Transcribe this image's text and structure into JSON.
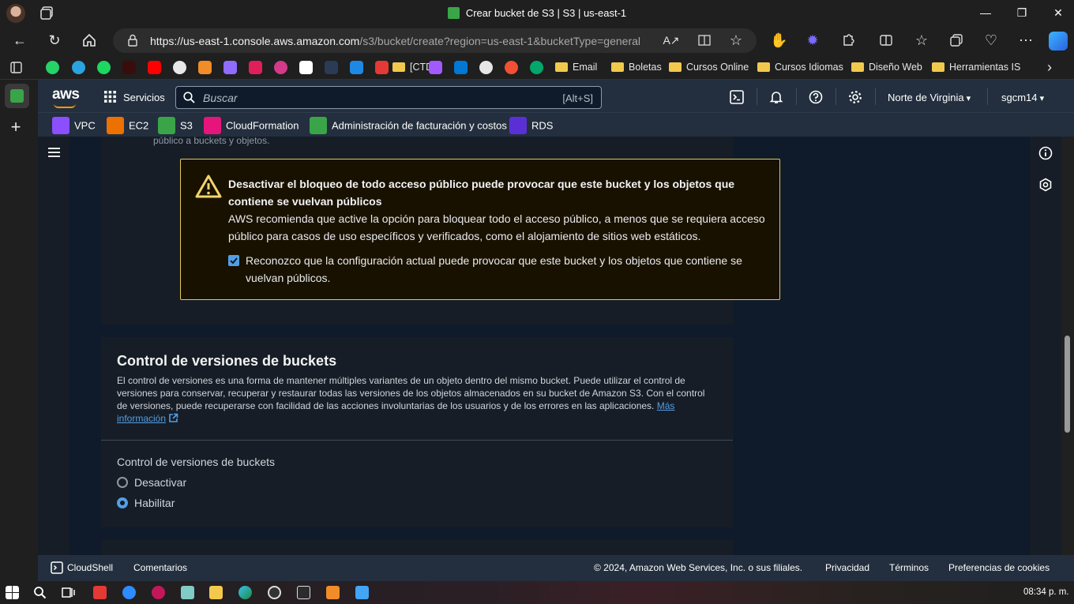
{
  "browser": {
    "window_title": "Crear bucket de S3 | S3 | us-east-1",
    "url_host": "https://us-east-1.console.aws.amazon.com",
    "url_path": "/s3/bucket/create?region=us-east-1&bucketType=general",
    "bookmarks": {
      "ctd": "[CTD]",
      "folders": [
        "Email",
        "Boletas",
        "Cursos Online",
        "Cursos Idiomas",
        "Diseño Web",
        "Herramientas IS"
      ]
    }
  },
  "aws_header": {
    "logo": "aws",
    "services_label": "Servicios",
    "search_placeholder": "Buscar",
    "search_shortcut": "[Alt+S]",
    "region": "Norte de Virginia",
    "account": "sgcm14"
  },
  "favorites": [
    {
      "label": "VPC",
      "color": "#8c4fff"
    },
    {
      "label": "EC2",
      "color": "#ed7100"
    },
    {
      "label": "S3",
      "color": "#3aa548"
    },
    {
      "label": "CloudFormation",
      "color": "#e7157b"
    },
    {
      "label": "Administración de facturación y costos",
      "color": "#3aa548"
    },
    {
      "label": "RDS",
      "color": "#5a30d6"
    }
  ],
  "content": {
    "prev_section_tail": "público a buckets y objetos.",
    "warning": {
      "title": "Desactivar el bloqueo de todo acceso público puede provocar que este bucket y los objetos que contiene se vuelvan públicos",
      "body": "AWS recomienda que active la opción para bloquear todo el acceso público, a menos que se requiera acceso público para casos de uso específicos y verificados, como el alojamiento de sitios web estáticos.",
      "checkbox_label": "Reconozco que la configuración actual puede provocar que este bucket y los objetos que contiene se vuelvan públicos.",
      "checked": true
    },
    "versioning": {
      "heading": "Control de versiones de buckets",
      "description": "El control de versiones es una forma de mantener múltiples variantes de un objeto dentro del mismo bucket. Puede utilizar el control de versiones para conservar, recuperar y restaurar todas las versiones de los objetos almacenados en su bucket de Amazon S3. Con el control de versiones, puede recuperarse con facilidad de las acciones involuntarias de los usuarios y de los errores en las aplicaciones.",
      "more_info": "Más información",
      "field_label": "Control de versiones de buckets",
      "options": [
        "Desactivar",
        "Habilitar"
      ],
      "selected": "Habilitar"
    }
  },
  "footer": {
    "cloudshell": "CloudShell",
    "comments": "Comentarios",
    "copyright": "© 2024, Amazon Web Services, Inc. o sus filiales.",
    "privacy": "Privacidad",
    "terms": "Términos",
    "cookies": "Preferencias de cookies"
  },
  "taskbar": {
    "clock": "08:34 p. m."
  },
  "colors": {
    "aws_nav": "#232f3e",
    "content_bg": "#0f1b2a",
    "panel_bg": "#161d26",
    "warning_border": "#e0ca57",
    "link": "#539fe5",
    "aws_orange": "#ff9900"
  }
}
